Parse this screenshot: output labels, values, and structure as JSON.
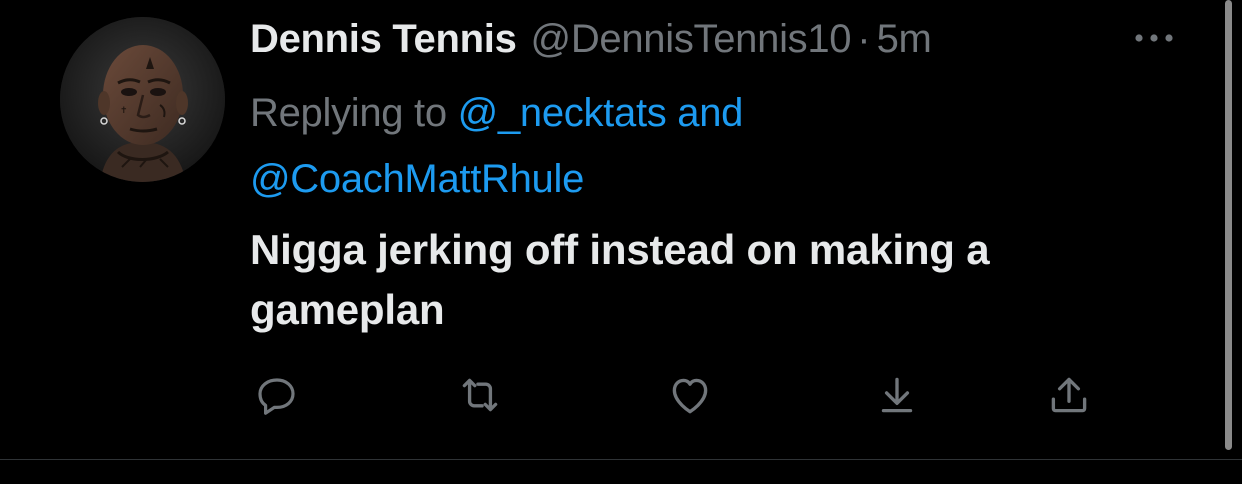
{
  "tweet": {
    "display_name": "Dennis Tennis",
    "handle": "@DennisTennis10",
    "separator": "·",
    "time": "5m",
    "reply_prefix": "Replying to ",
    "mention_1": "@_necktats",
    "mention_joiner": " and",
    "mention_2": "@CoachMattRhule",
    "text": "Nigga jerking off instead on making a gameplan"
  },
  "icons": {
    "more": "more-horizontal-icon",
    "reply": "reply-icon",
    "retweet": "retweet-icon",
    "like": "heart-icon",
    "download": "download-icon",
    "share": "share-icon"
  },
  "colors": {
    "background": "#000000",
    "primary_text": "#e7e9ea",
    "secondary_text": "#71767b",
    "link": "#1d9bf0",
    "divider": "#2f3336"
  }
}
